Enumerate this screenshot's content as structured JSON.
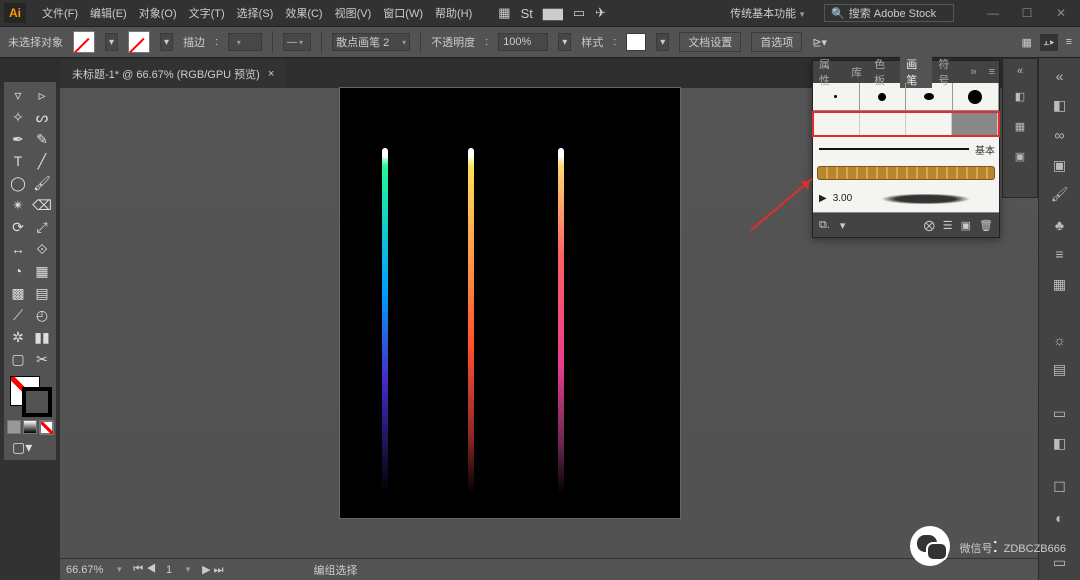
{
  "app": {
    "badge": "Ai"
  },
  "menu": [
    "文件(F)",
    "编辑(E)",
    "对象(O)",
    "文字(T)",
    "选择(S)",
    "效果(C)",
    "视图(V)",
    "窗口(W)",
    "帮助(H)"
  ],
  "workspace": "传统基本功能",
  "search_placeholder": "搜索 Adobe Stock",
  "control": {
    "no_selection": "未选择对象",
    "stroke_label": "描边",
    "brush_dd": "散点画笔 2",
    "opacity_label": "不透明度",
    "opacity_value": "100%",
    "style_label": "样式",
    "doc_setup": "文档设置",
    "prefs": "首选项"
  },
  "tab": {
    "title": "未标题-1* @ 66.67% (RGB/GPU 预览)",
    "close": "×"
  },
  "brushes": {
    "tabs": [
      "属性",
      "库",
      "色板",
      "画笔",
      "符号"
    ],
    "more": "»",
    "active_tab_index": 3,
    "basic_label": "基本",
    "size_value": "3.00",
    "arrow_linked": true
  },
  "status": {
    "zoom": "66.67%",
    "nav": "1",
    "label": "编组选择"
  },
  "watermark": {
    "label": "微信号",
    "id": "ZDBCZB666"
  }
}
